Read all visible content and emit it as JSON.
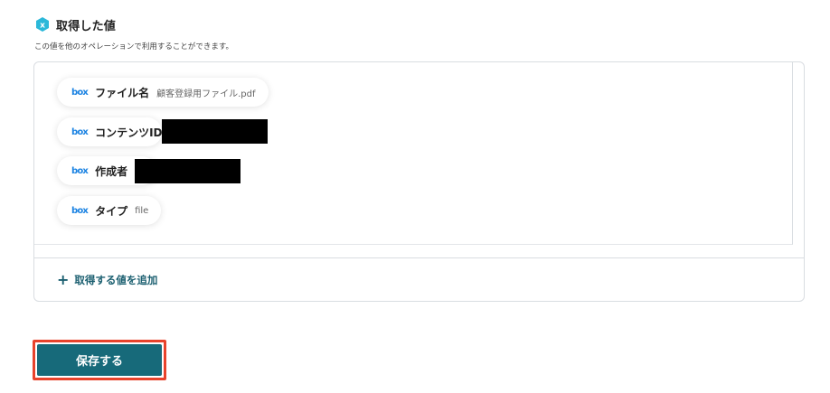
{
  "section": {
    "title": "取得した値",
    "description": "この値を他のオペレーションで利用することができます。"
  },
  "fields": [
    {
      "icon": "box",
      "label": "ファイル名",
      "value": "顧客登録用ファイル.pdf",
      "redacted": false
    },
    {
      "icon": "box",
      "label": "コンテンツID",
      "value": "",
      "redacted": true
    },
    {
      "icon": "box",
      "label": "作成者",
      "value": "",
      "redacted": true
    },
    {
      "icon": "box",
      "label": "タイプ",
      "value": "file",
      "redacted": false
    }
  ],
  "actions": {
    "add_value_label": "取得する値を追加",
    "save_label": "保存する"
  },
  "colors": {
    "accent": "#176a7a",
    "highlight": "#e8432c",
    "box_brand": "#1a82e2",
    "title_icon": "#2bb8d9"
  }
}
